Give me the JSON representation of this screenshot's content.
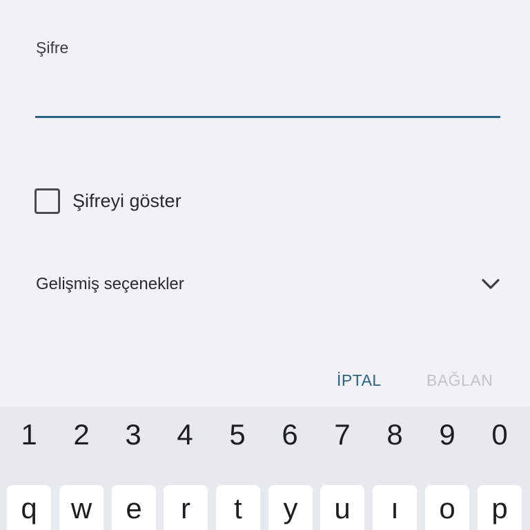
{
  "dialog": {
    "password_label": "Şifre",
    "password_value": "",
    "show_password_label": "Şifreyi göster",
    "show_password_checked": false,
    "advanced_options_label": "Gelişmiş seçenekler",
    "cancel_label": "İPTAL",
    "connect_label": "BAĞLAN"
  },
  "keyboard": {
    "numbers": [
      "1",
      "2",
      "3",
      "4",
      "5",
      "6",
      "7",
      "8",
      "9",
      "0"
    ],
    "letters": [
      "q",
      "w",
      "e",
      "r",
      "t",
      "y",
      "u",
      "ı",
      "o",
      "p"
    ]
  },
  "colors": {
    "accent": "#2a6381",
    "disabled": "#c3c3c7",
    "background": "#f2f1f6",
    "keyboard_background": "#e8e8ef",
    "key_background": "#ffffff"
  },
  "icons": {
    "advanced_toggle": "chevron-down-icon"
  }
}
